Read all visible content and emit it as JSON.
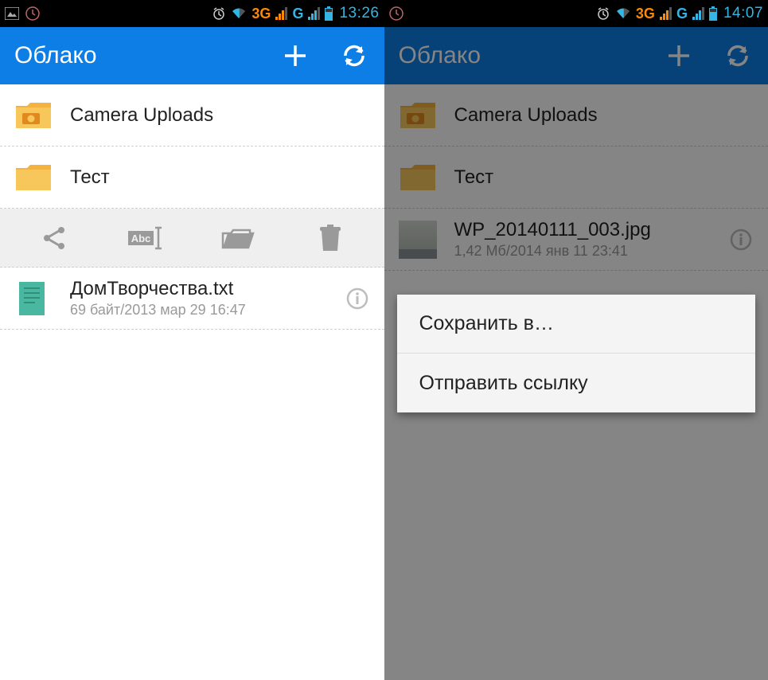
{
  "left": {
    "status": {
      "time": "13:26",
      "net1": "3G",
      "net2": "G"
    },
    "appbar": {
      "title": "Облако"
    },
    "items": [
      {
        "name": "Camera Uploads",
        "type": "camera-folder"
      },
      {
        "name": "Тест",
        "type": "folder"
      }
    ],
    "selected_file": {
      "name": "ДомТворчества.txt",
      "meta": "69 байт/2013 мар 29 16:47"
    }
  },
  "right": {
    "status": {
      "time": "14:07",
      "net1": "3G",
      "net2": "G"
    },
    "appbar": {
      "title": "Облако"
    },
    "items": [
      {
        "name": "Camera Uploads",
        "type": "camera-folder"
      },
      {
        "name": "Тест",
        "type": "folder"
      },
      {
        "name": "WP_20140111_003.jpg",
        "meta": "1,42 Мб/2014 янв 11 23:41",
        "type": "image"
      }
    ],
    "menu": {
      "option1": "Сохранить в…",
      "option2": "Отправить ссылку"
    }
  }
}
